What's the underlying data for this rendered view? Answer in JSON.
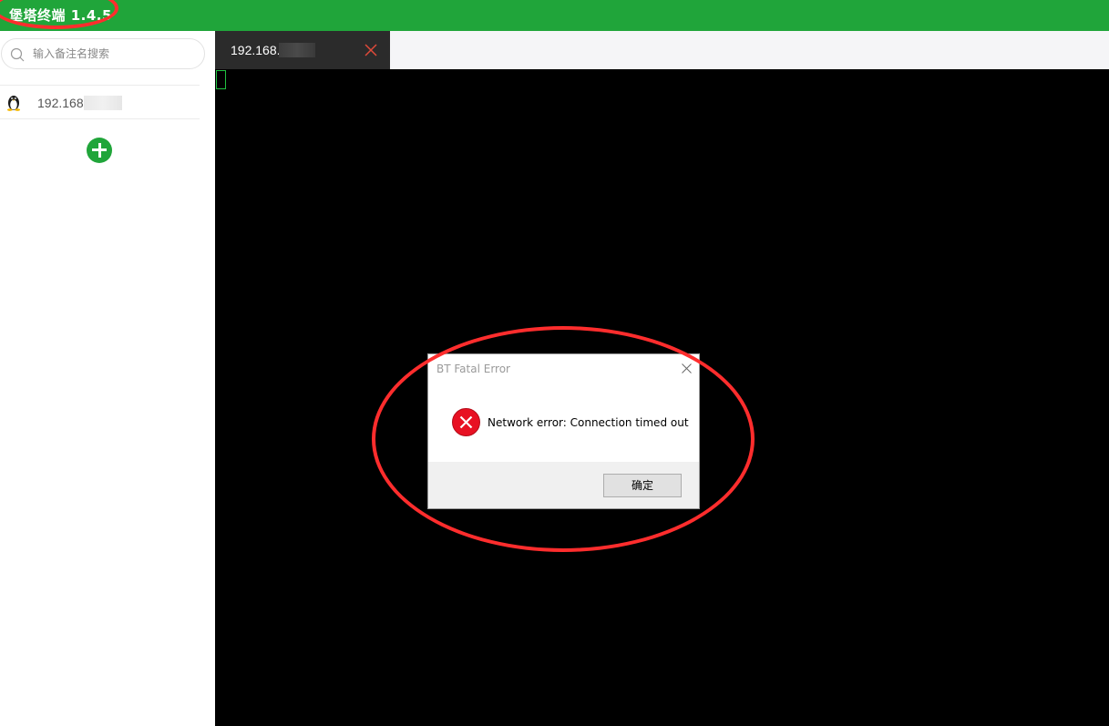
{
  "app": {
    "title": "堡塔终端 1.4.5"
  },
  "sidebar": {
    "search": {
      "placeholder": "输入备注名搜索",
      "value": ""
    },
    "servers": [
      {
        "label": "192.168",
        "icon": "linux-penguin-icon"
      }
    ],
    "add_icon": "plus-circle-icon"
  },
  "tabs": [
    {
      "label": "192.168.",
      "active": true
    }
  ],
  "dialog": {
    "title": "BT Fatal Error",
    "message": "Network error: Connection timed out",
    "ok_label": "确定",
    "icon": "error-x-icon"
  },
  "colors": {
    "brand": "#20a53a",
    "terminal_bg": "#000000",
    "tab_bg": "#2b2b2b",
    "annotation": "#ff2d2d",
    "error": "#e81123"
  }
}
